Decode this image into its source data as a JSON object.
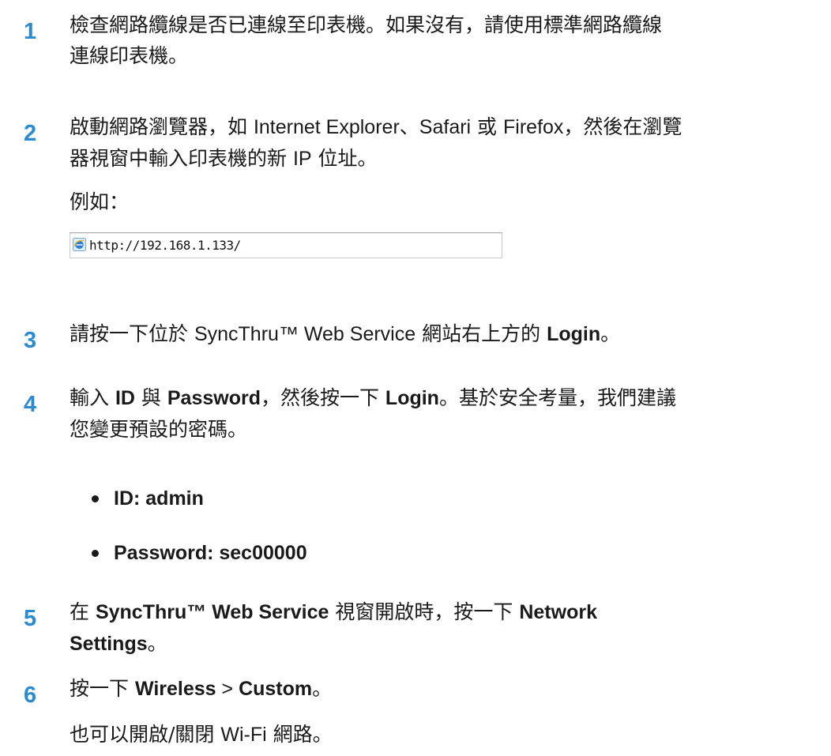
{
  "steps": {
    "s1": {
      "num": "1",
      "line1": "檢查網路纜線是否已連線至印表機。如果沒有，請使用標準網路纜線",
      "line2": "連線印表機。"
    },
    "s2": {
      "num": "2",
      "a": "啟動網路瀏覽器，如 ",
      "b": "Internet Explorer",
      "c": "、",
      "d": "Safari",
      "e": " 或 ",
      "f": "Firefox",
      "g": "，然後在瀏覽",
      "line2a": "器視窗中輸入印表機的新 ",
      "line2b": "IP",
      "line2c": " 位址。",
      "example": "例如："
    },
    "s3": {
      "num": "3",
      "a": "請按一下位於 ",
      "b": "SyncThru™ Web Service",
      "c": " 網站右上方的 ",
      "login": "Login",
      "d": "。"
    },
    "s4": {
      "num": "4",
      "a": "輸入 ",
      "id": "ID",
      "b": " 與 ",
      "password": "Password",
      "c": "，然後按一下 ",
      "login": "Login",
      "d": "。基於安全考量，我們建議",
      "line2": "您變更預設的密碼。"
    },
    "s5": {
      "num": "5",
      "a": "在 ",
      "sws": "SyncThru™ Web Service",
      "b": " 視窗開啟時，按一下 ",
      "net": "Network",
      "settings": "Settings",
      "c": "。"
    },
    "s6": {
      "num": "6",
      "a": "按一下 ",
      "wireless": "Wireless",
      "gt": " > ",
      "custom": "Custom",
      "b": "。",
      "note_a": "也可以開啟/關閉 ",
      "note_b": "Wi-Fi",
      "note_c": " 網路。"
    }
  },
  "address_bar": {
    "url": "http://192.168.1.133/",
    "icon": "ie-browser-icon"
  },
  "bullets": [
    "ID: admin",
    "Password: sec00000"
  ],
  "colors": {
    "step_number": "#2c8bd0",
    "text": "#1a1a1a"
  }
}
